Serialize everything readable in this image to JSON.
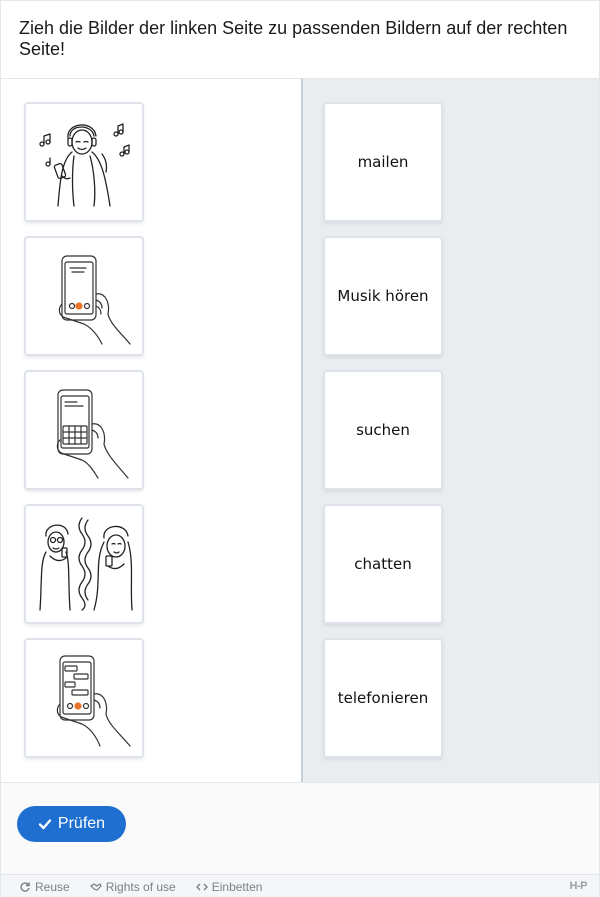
{
  "task": {
    "instruction": "Zieh die Bilder der linken Seite zu passenden Bildern auf der rechten Seite!"
  },
  "images": [
    {
      "icon": "woman-listening-music-icon"
    },
    {
      "icon": "phone-call-hand-icon"
    },
    {
      "icon": "phone-search-hand-icon"
    },
    {
      "icon": "two-people-chatting-icon"
    },
    {
      "icon": "phone-chat-hand-icon"
    }
  ],
  "words": [
    "mailen",
    "Musik hören",
    "suchen",
    "chatten",
    "telefonieren"
  ],
  "actions": {
    "check_label": "Prüfen"
  },
  "meta": {
    "reuse": "Reuse",
    "rights": "Rights of use",
    "embed": "Einbetten",
    "logo": "H-P"
  },
  "colors": {
    "button": "#1f6fd1",
    "right_pane": "#e9edf0"
  }
}
